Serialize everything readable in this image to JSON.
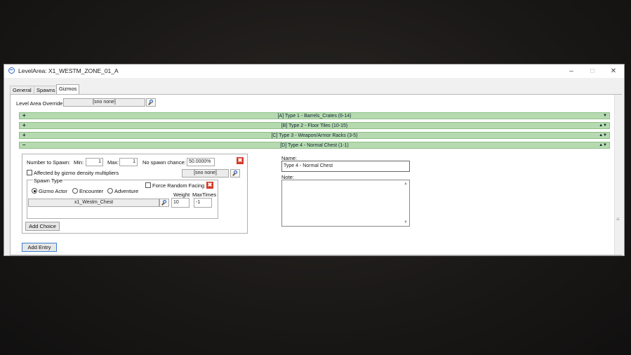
{
  "window": {
    "title": "LevelArea: X1_WESTM_ZONE_01_A",
    "minimize": "–",
    "maximize": "☐",
    "close": "✕"
  },
  "tabs": [
    {
      "label": "General",
      "active": false
    },
    {
      "label": "Spawns",
      "active": false
    },
    {
      "label": "Gizmos",
      "active": true
    }
  ],
  "override": {
    "label": "Level Area Override",
    "value": "[sno none]"
  },
  "sections": [
    {
      "sign": "+",
      "label": "[A] Type 1 - Barrels_Crates (6-14)",
      "arrows": "▼"
    },
    {
      "sign": "+",
      "label": "[B] Type 2 - Floor Tiles (10-15)",
      "arrows": "▲▼"
    },
    {
      "sign": "+",
      "label": "[C] Type 3 - Weapon/Armor Racks (3-5)",
      "arrows": "▲▼"
    },
    {
      "sign": "–",
      "label": "[D] Type 4 - Normal Chest (1-1)",
      "arrows": "▲▼"
    }
  ],
  "entry": {
    "number_to_spawn_label": "Number to Spawn:",
    "min_label": "Min:",
    "min_value": "1",
    "max_label": "Max:",
    "max_value": "1",
    "no_spawn_label": "No spawn chance:",
    "no_spawn_value": "50.0000%",
    "remove_glyph": "✖",
    "density_label": "Affected by gizmo density multipliers",
    "density_sno": "[sno none]",
    "spawn_type_label": "Spawn Type",
    "spawn_types": [
      {
        "label": "Gizmo Actor",
        "selected": true
      },
      {
        "label": "Encounter",
        "selected": false
      },
      {
        "label": "Adventure",
        "selected": false
      }
    ],
    "force_random_label": "Force Random Facing",
    "actor_value": "x1_Westm_Chest",
    "weight_label": "Weight",
    "weight_value": "10",
    "maxtimes_label": "MaxTimes",
    "maxtimes_value": "-1",
    "add_choice_label": "Add Choice"
  },
  "details": {
    "name_label": "Name:",
    "name_value": "Type 4 - Normal Chest",
    "note_label": "Note:",
    "note_value": ""
  },
  "add_entry_label": "Add Entry",
  "scroll_grip": "≡"
}
